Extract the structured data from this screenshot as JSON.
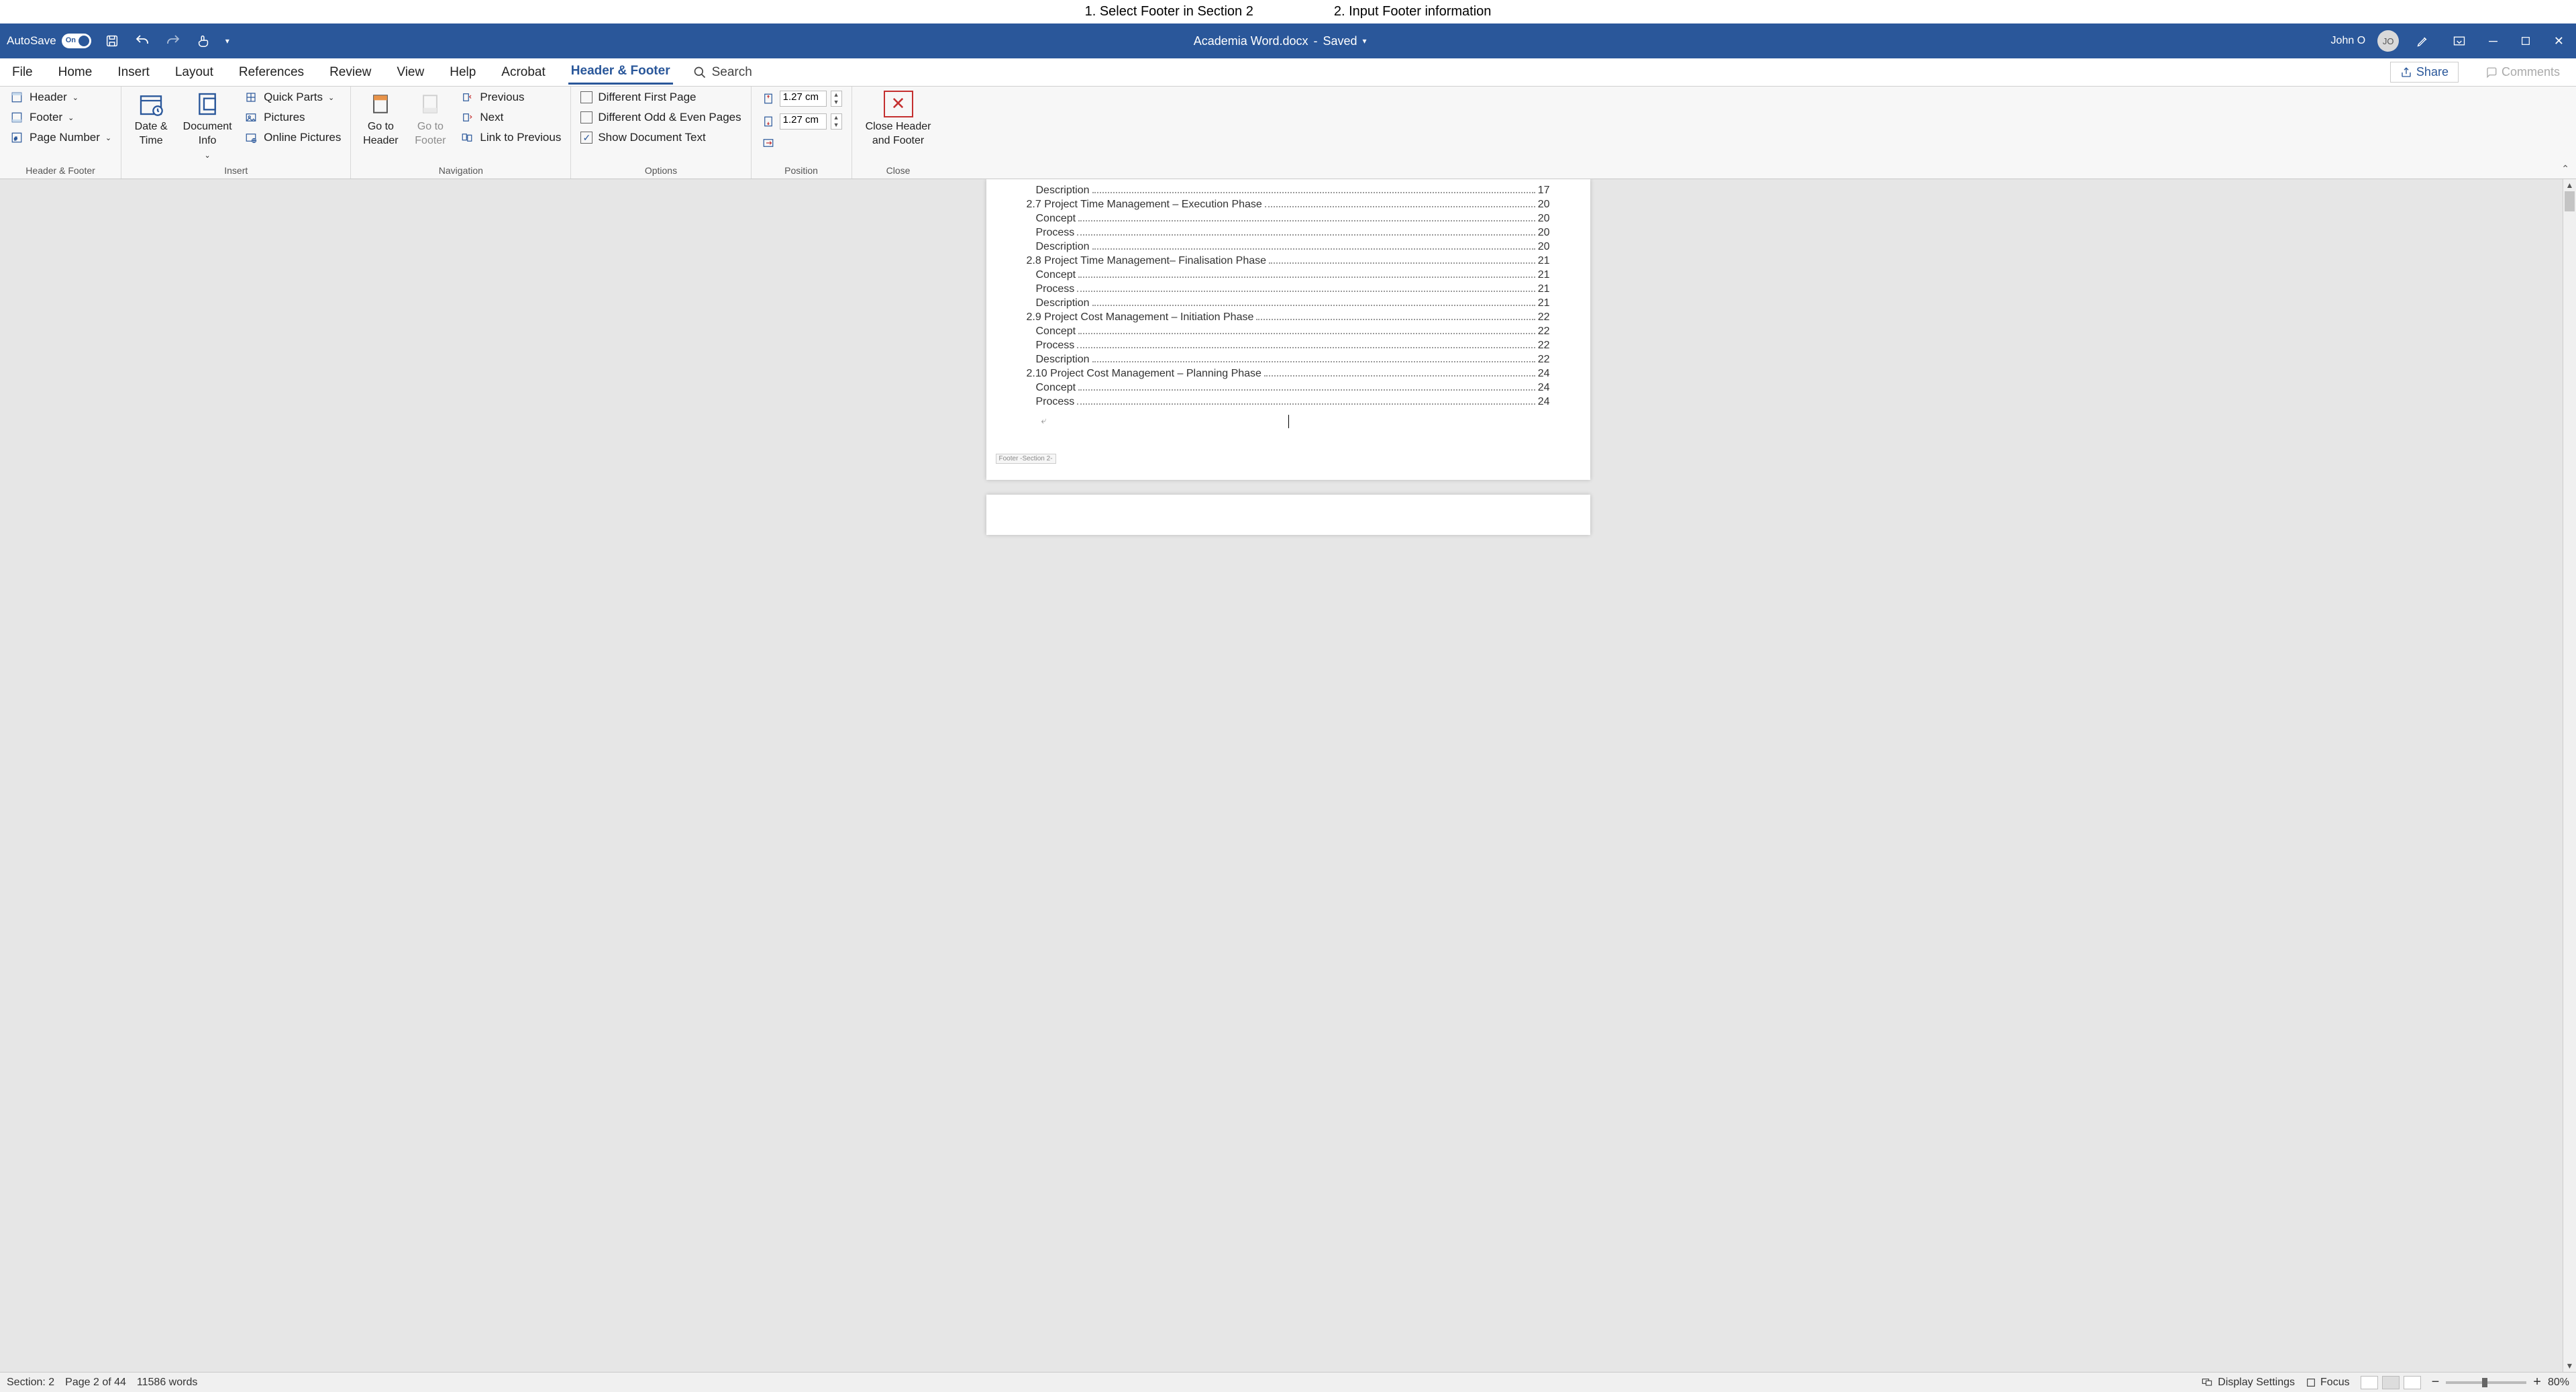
{
  "instructions": {
    "step1": "1. Select Footer in Section 2",
    "step2": "2. Input Footer information"
  },
  "titlebar": {
    "autosave_label": "AutoSave",
    "autosave_on": "On",
    "doc_name": "Academia Word.docx",
    "saved_label": "Saved",
    "user_name": "John O",
    "user_initials": "JO"
  },
  "tabs": {
    "file": "File",
    "home": "Home",
    "insert": "Insert",
    "layout": "Layout",
    "references": "References",
    "review": "Review",
    "view": "View",
    "help": "Help",
    "acrobat": "Acrobat",
    "header_footer": "Header & Footer",
    "search": "Search",
    "share": "Share",
    "comments": "Comments"
  },
  "ribbon": {
    "hf_group": "Header & Footer",
    "header": "Header",
    "footer": "Footer",
    "page_number": "Page Number",
    "insert_group": "Insert",
    "date_time": "Date & Time",
    "doc_info": "Document Info",
    "quick_parts": "Quick Parts",
    "pictures": "Pictures",
    "online_pictures": "Online Pictures",
    "nav_group": "Navigation",
    "goto_header": "Go to Header",
    "goto_footer": "Go to Footer",
    "previous": "Previous",
    "next": "Next",
    "link_previous": "Link to Previous",
    "options_group": "Options",
    "diff_first": "Different First Page",
    "diff_odd_even": "Different Odd & Even Pages",
    "show_doc_text": "Show Document Text",
    "position_group": "Position",
    "header_top": "1.27 cm",
    "footer_bottom": "1.27 cm",
    "close_group": "Close",
    "close_hf": "Close Header and Footer"
  },
  "toc": [
    {
      "level": 1,
      "text": "Description",
      "page": "17"
    },
    {
      "level": 0,
      "text": "2.7 Project Time Management – Execution Phase",
      "page": "20"
    },
    {
      "level": 1,
      "text": "Concept",
      "page": "20"
    },
    {
      "level": 1,
      "text": "Process",
      "page": "20"
    },
    {
      "level": 1,
      "text": "Description",
      "page": "20"
    },
    {
      "level": 0,
      "text": "2.8 Project Time Management– Finalisation Phase",
      "page": "21"
    },
    {
      "level": 1,
      "text": "Concept",
      "page": "21"
    },
    {
      "level": 1,
      "text": "Process",
      "page": "21"
    },
    {
      "level": 1,
      "text": "Description",
      "page": "21"
    },
    {
      "level": 0,
      "text": "2.9 Project Cost Management – Initiation Phase",
      "page": "22"
    },
    {
      "level": 1,
      "text": "Concept",
      "page": "22"
    },
    {
      "level": 1,
      "text": "Process",
      "page": "22"
    },
    {
      "level": 1,
      "text": "Description",
      "page": "22"
    },
    {
      "level": 0,
      "text": "2.10 Project Cost Management – Planning Phase",
      "page": "24"
    },
    {
      "level": 1,
      "text": "Concept",
      "page": "24"
    },
    {
      "level": 1,
      "text": "Process",
      "page": "24"
    }
  ],
  "footer_tag": "Footer -Section 2-",
  "statusbar": {
    "section": "Section: 2",
    "page": "Page 2 of 44",
    "words": "11586 words",
    "display_settings": "Display Settings",
    "focus": "Focus",
    "zoom": "80%"
  }
}
